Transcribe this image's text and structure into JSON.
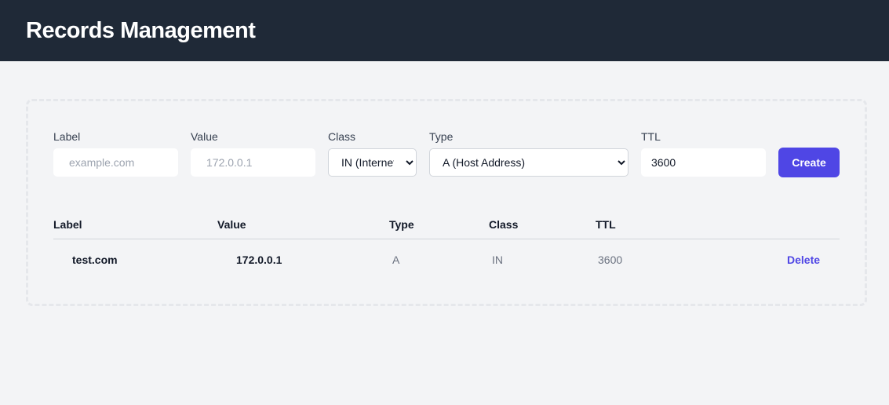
{
  "header": {
    "title": "Records Management"
  },
  "form": {
    "label": {
      "label": "Label",
      "placeholder": "example.com",
      "value": ""
    },
    "value": {
      "label": "Value",
      "placeholder": "172.0.0.1",
      "value": ""
    },
    "class": {
      "label": "Class",
      "selected": "IN (Internet)"
    },
    "type": {
      "label": "Type",
      "selected": "A (Host Address)"
    },
    "ttl": {
      "label": "TTL",
      "value": "3600"
    },
    "create_label": "Create"
  },
  "table": {
    "headers": [
      "Label",
      "Value",
      "Type",
      "Class",
      "TTL"
    ],
    "rows": [
      {
        "label": "test.com",
        "value": "172.0.0.1",
        "type": "A",
        "class": "IN",
        "ttl": "3600",
        "action": "Delete"
      }
    ]
  },
  "colors": {
    "header_bg": "#1f2937",
    "accent": "#4f46e5",
    "page_bg": "#f3f4f6"
  }
}
